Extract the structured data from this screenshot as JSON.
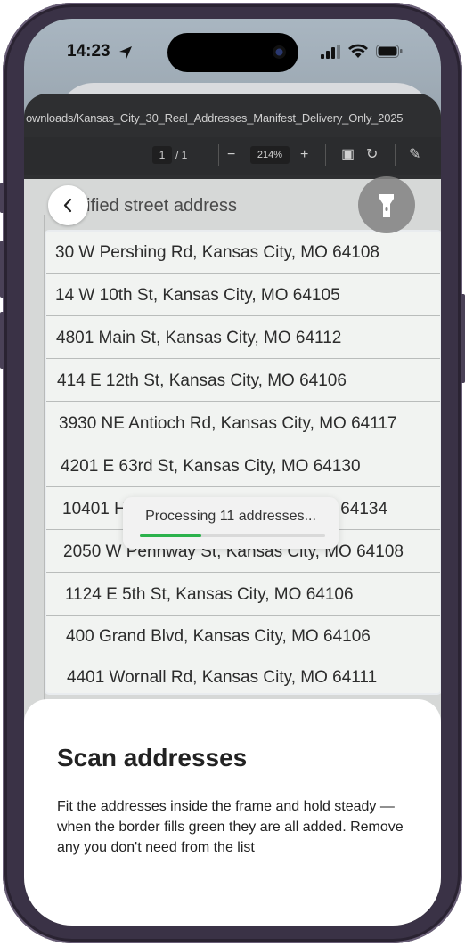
{
  "status_bar": {
    "time": "14:23"
  },
  "pdf_viewer": {
    "file_path": "ownloads/Kansas_City_30_Real_Addresses_Manifest_Delivery_Only_2025",
    "page_current": "1",
    "page_total": "/ 1",
    "zoom": "214%",
    "column_header": "ified street address"
  },
  "addresses": [
    "30 W Pershing Rd, Kansas City, MO 64108",
    "14 W 10th St, Kansas City, MO 64105",
    "4801 Main St, Kansas City, MO 64112",
    "414 E 12th St, Kansas City, MO 64106",
    "3930 NE Antioch Rd, Kansas City, MO 64117",
    "4201 E 63rd St, Kansas City, MO 64130",
    "10401 Hillcrest Rd, Kansas City, MO 64134",
    "2050 W Pennway St, Kansas City, MO 64108",
    "1124 E 5th St, Kansas City, MO 64106",
    "400 Grand Blvd, Kansas City, MO 64106",
    "4401 Wornall Rd, Kansas City, MO 64111"
  ],
  "toast": {
    "text": "Processing 11 addresses...",
    "progress": 0.33,
    "progress_color": "#2bb24c"
  },
  "sheet": {
    "title": "Scan addresses",
    "description": "Fit the addresses inside the frame and hold steady — when the border fills green they are all added. Remove any you don't need from the list"
  },
  "icons": {
    "back": "chevron-left-icon",
    "torch": "flashlight-icon",
    "location": "location-arrow-icon",
    "signal": "cellular-signal-icon",
    "wifi": "wifi-icon",
    "battery": "battery-icon"
  }
}
